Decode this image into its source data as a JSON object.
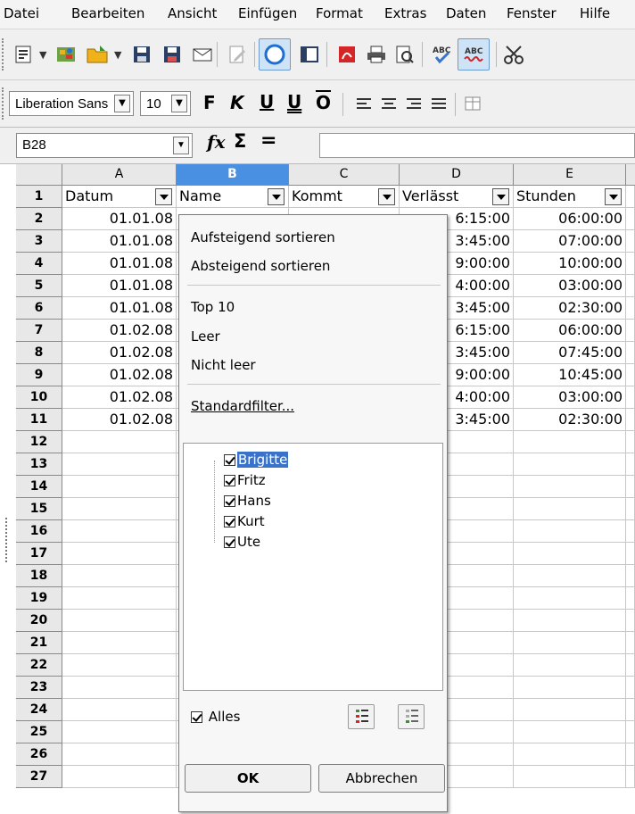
{
  "menubar": {
    "items": [
      "Datei",
      "Bearbeiten",
      "Ansicht",
      "Einfügen",
      "Format",
      "Extras",
      "Daten",
      "Fenster",
      "Hilfe"
    ]
  },
  "format_bar": {
    "font_name": "Liberation Sans",
    "font_size": "10",
    "bold_label": "F",
    "italic_label": "K",
    "underline_label": "U",
    "double_underline_label": "U",
    "overline_label": "O"
  },
  "formula_bar": {
    "name_box": "B28",
    "function_wizard_label": "fx",
    "sum_label": "Σ",
    "equals_label": "=",
    "content": ""
  },
  "sheet": {
    "columns": [
      "A",
      "B",
      "C",
      "D",
      "E"
    ],
    "rows": [
      "1",
      "2",
      "3",
      "4",
      "5",
      "6",
      "7",
      "8",
      "9",
      "10",
      "11",
      "12",
      "13",
      "14",
      "15",
      "16",
      "17",
      "18",
      "19",
      "20",
      "21",
      "22",
      "23",
      "24",
      "25",
      "26",
      "27"
    ],
    "header_row": [
      "Datum",
      "Name",
      "Kommt",
      "Verlässt",
      "Stunden"
    ],
    "data": [
      {
        "datum": "01.01.08",
        "verlaesst": "6:15:00",
        "stunden": "06:00:00"
      },
      {
        "datum": "01.01.08",
        "verlaesst": "3:45:00",
        "stunden": "07:00:00"
      },
      {
        "datum": "01.01.08",
        "verlaesst": "9:00:00",
        "stunden": "10:00:00"
      },
      {
        "datum": "01.01.08",
        "verlaesst": "4:00:00",
        "stunden": "03:00:00"
      },
      {
        "datum": "01.01.08",
        "verlaesst": "3:45:00",
        "stunden": "02:30:00"
      },
      {
        "datum": "01.02.08",
        "verlaesst": "6:15:00",
        "stunden": "06:00:00"
      },
      {
        "datum": "01.02.08",
        "verlaesst": "3:45:00",
        "stunden": "07:45:00"
      },
      {
        "datum": "01.02.08",
        "verlaesst": "9:00:00",
        "stunden": "10:45:00"
      },
      {
        "datum": "01.02.08",
        "verlaesst": "4:00:00",
        "stunden": "03:00:00"
      },
      {
        "datum": "01.02.08",
        "verlaesst": "3:45:00",
        "stunden": "02:30:00"
      }
    ]
  },
  "autofilter": {
    "sort_ascending": "Aufsteigend sortieren",
    "sort_descending": "Absteigend sortieren",
    "top10": "Top 10",
    "empty": "Leer",
    "not_empty": "Nicht leer",
    "standard_filter": "Standardfilter...",
    "values": [
      "Brigitte",
      "Fritz",
      "Hans",
      "Kurt",
      "Ute"
    ],
    "selected_value": "Brigitte",
    "all_label": "Alles",
    "ok_label": "OK",
    "cancel_label": "Abbrechen"
  },
  "colors": {
    "selection": "#3b72c9",
    "active_column_header": "#4a90e2",
    "toolbar_bg": "#f0f0f0"
  }
}
